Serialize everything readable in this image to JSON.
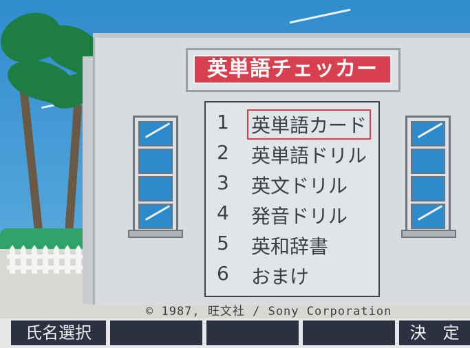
{
  "title": "英単語チェッカー",
  "menu": [
    {
      "num": "1",
      "label": "英単語カード",
      "selected": true
    },
    {
      "num": "2",
      "label": "英単語ドリル",
      "selected": false
    },
    {
      "num": "3",
      "label": "英文ドリル",
      "selected": false
    },
    {
      "num": "4",
      "label": "発音ドリル",
      "selected": false
    },
    {
      "num": "5",
      "label": "英和辞書",
      "selected": false
    },
    {
      "num": "6",
      "label": "おまけ",
      "selected": false
    }
  ],
  "copyright": "© 1987, 旺文社 / Sony Corporation",
  "softkeys": {
    "f1": "氏名選択",
    "f2": "",
    "f3": "",
    "f4": "",
    "f5": "決　定"
  },
  "colors": {
    "title_bar": "#d8404f",
    "sky": "#2f8ccd",
    "softkey_bg": "#2b3140"
  }
}
